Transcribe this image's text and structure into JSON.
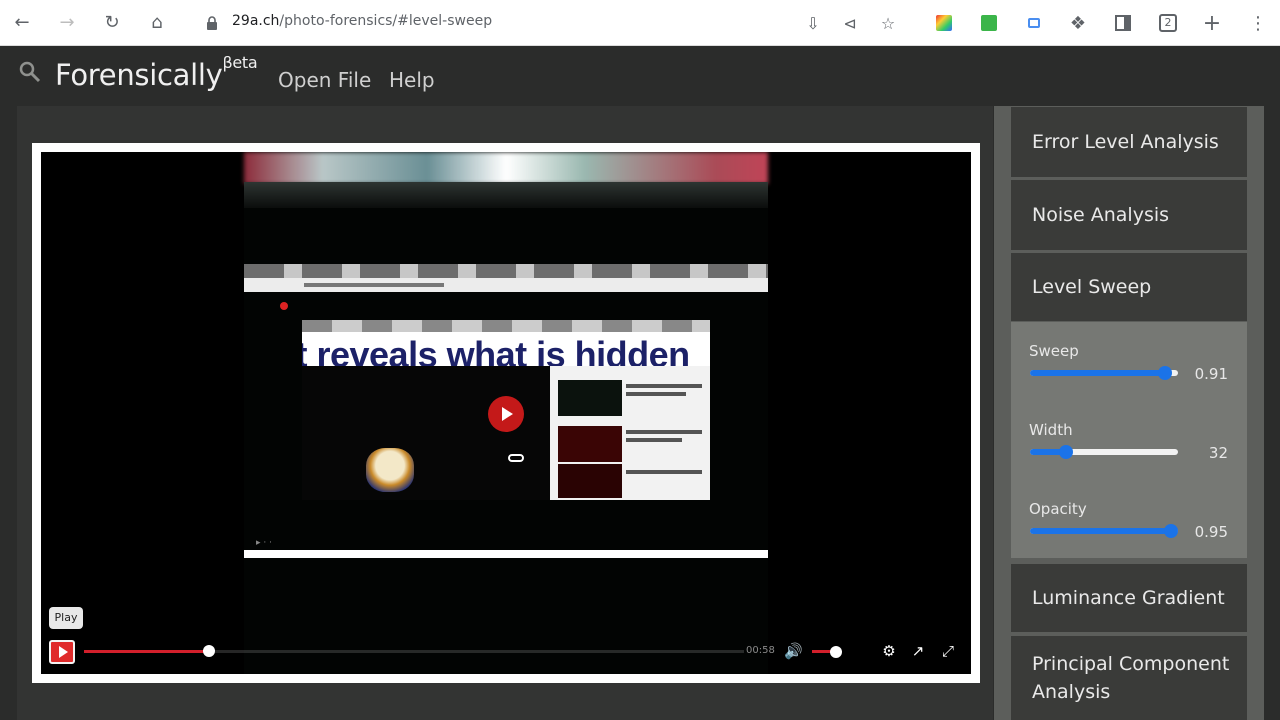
{
  "browser": {
    "url_domain": "29a.ch",
    "url_path": "/photo-forensics/#level-sweep",
    "tab_count": "2"
  },
  "app": {
    "brand": "Forensically",
    "brand_sup": "βeta",
    "menu": [
      "Open File",
      "Help"
    ]
  },
  "video": {
    "headline": "nt reveals what is hidden",
    "tooltip": "Play",
    "time": "00:58",
    "progress": 0.19,
    "volume": 0.8
  },
  "panel": {
    "items_above": [
      "Error Level Analysis",
      "Noise Analysis",
      "Level Sweep"
    ],
    "items_below": [
      "Luminance Gradient",
      "Principal Component Analysis"
    ],
    "sliders": [
      {
        "label": "Sweep",
        "value": "0.91",
        "fraction": 0.91
      },
      {
        "label": "Width",
        "value": "32",
        "fraction": 0.24
      },
      {
        "label": "Opacity",
        "value": "0.95",
        "fraction": 0.95
      }
    ]
  }
}
